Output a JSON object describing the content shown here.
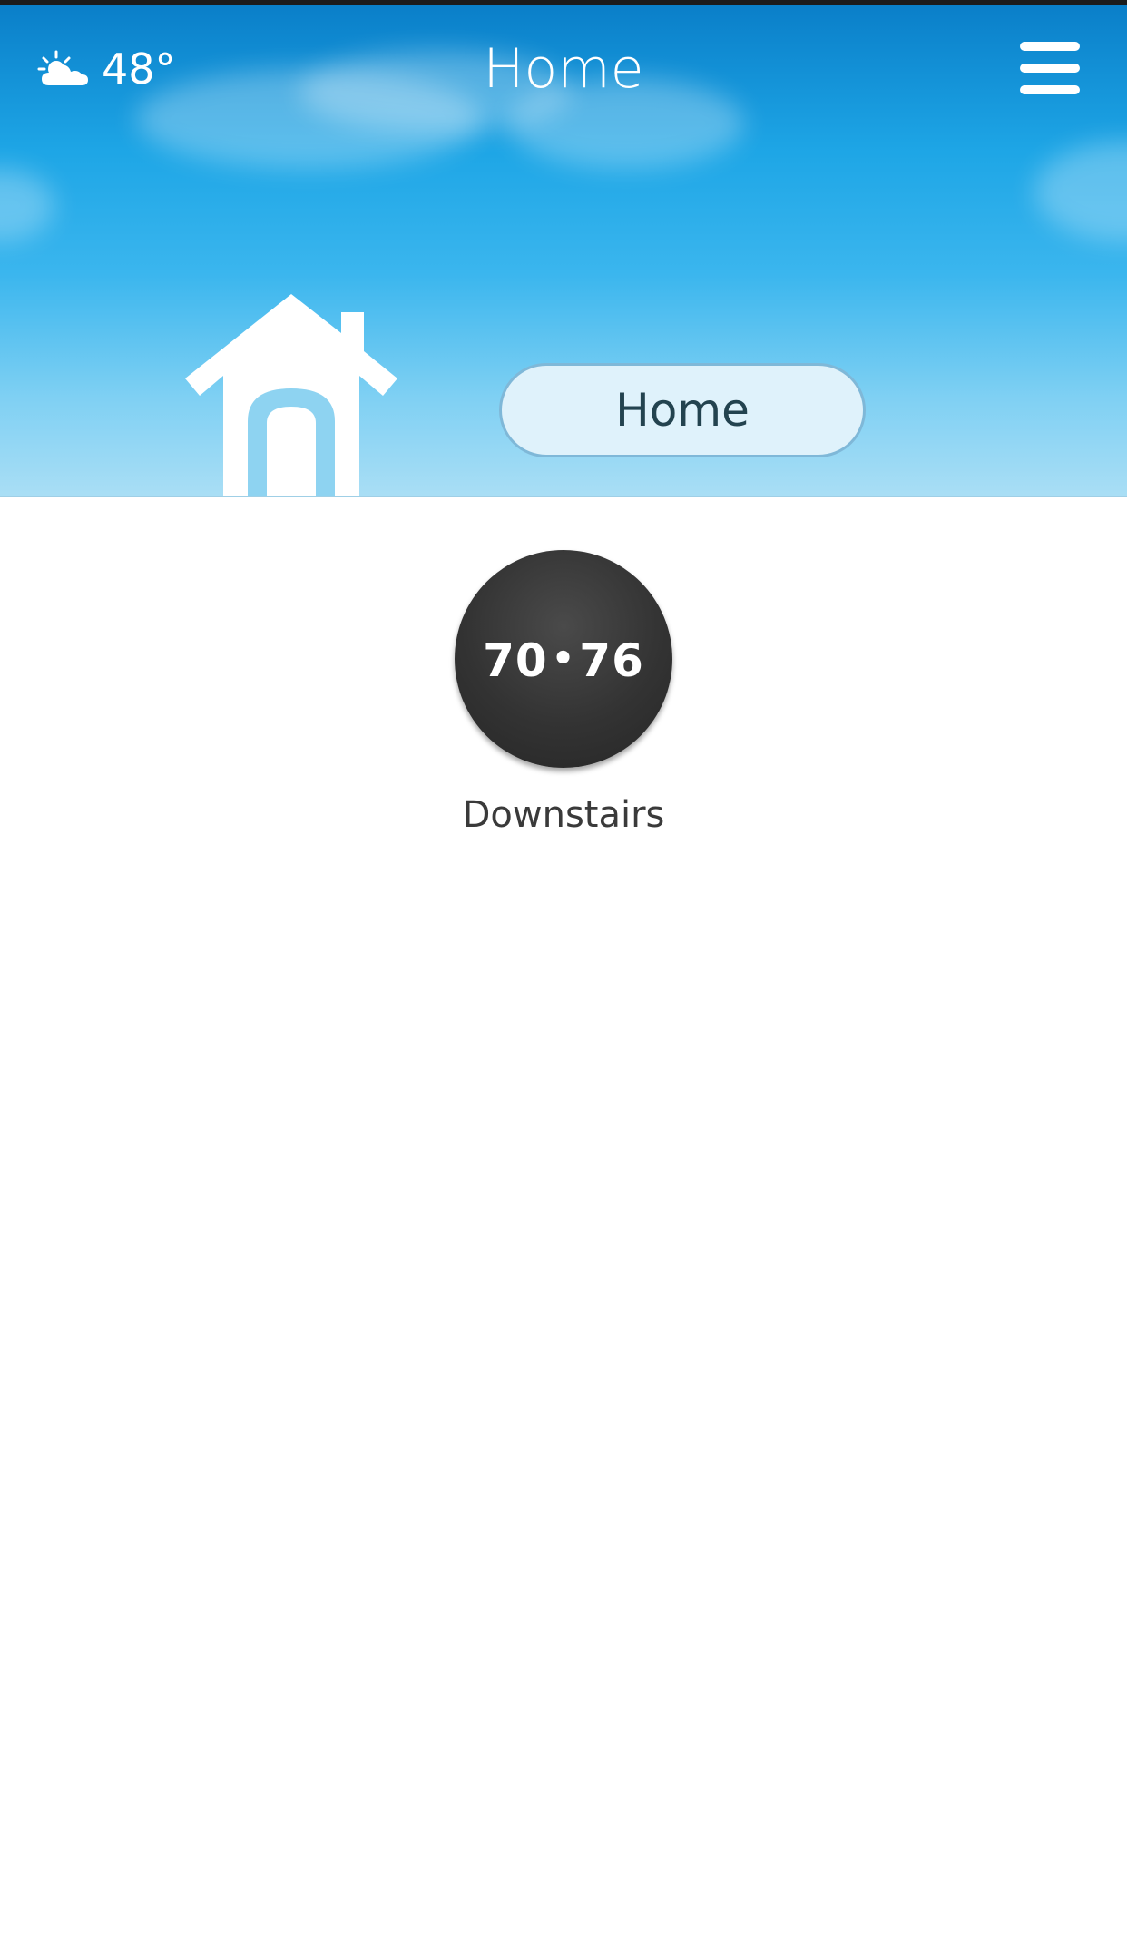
{
  "header": {
    "weather_icon": "partly-cloudy-icon",
    "temperature": "48°",
    "title": "Home",
    "menu_icon": "hamburger-menu-icon"
  },
  "structure": {
    "icon": "house-icon",
    "mode_label": "Home"
  },
  "devices": [
    {
      "icon": "thermostat-icon",
      "low_setpoint": "70",
      "high_setpoint": "76",
      "name": "Downstairs"
    }
  ],
  "colors": {
    "sky_top": "#0a7fc9",
    "sky_bottom": "#a9def5",
    "pill_background": "#dff2fb",
    "thermostat": "#333333",
    "house_door": "#8ed3f1"
  }
}
